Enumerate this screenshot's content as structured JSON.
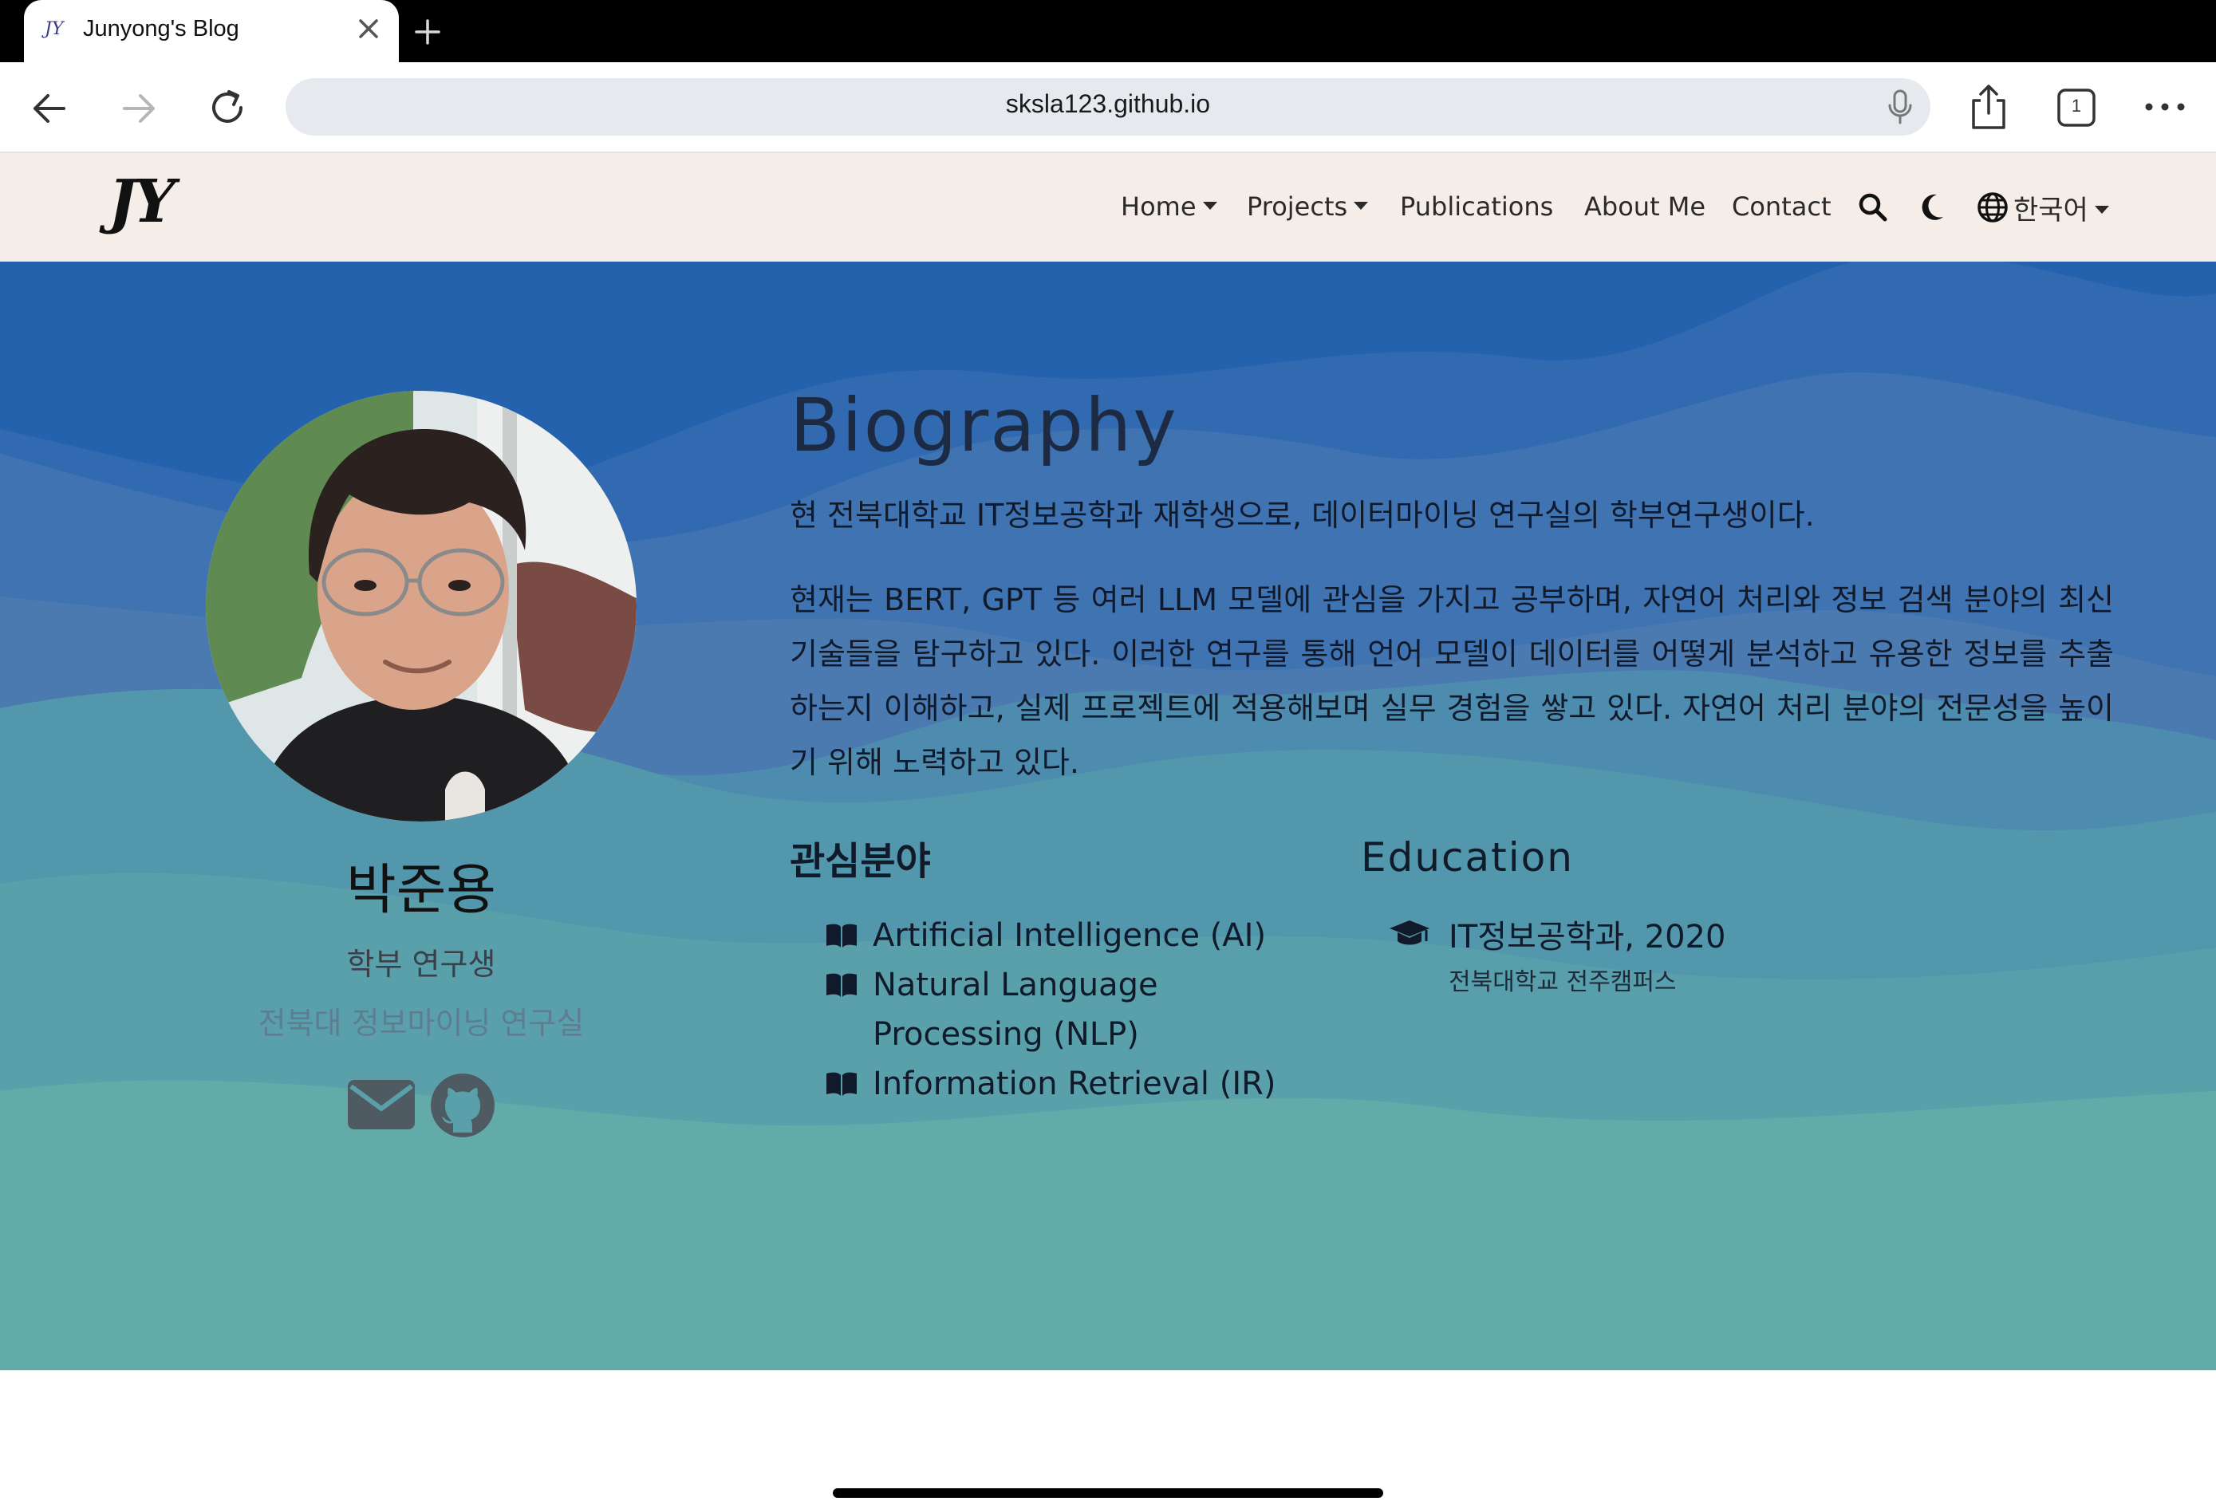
{
  "browser": {
    "tab": {
      "favicon_text": "JY",
      "title": "Junyong's Blog"
    },
    "url": "sksla123.github.io",
    "tabs_count": "1"
  },
  "navbar": {
    "logo": "JY",
    "items": [
      {
        "label": "Home",
        "dropdown": true
      },
      {
        "label": "Projects",
        "dropdown": true
      },
      {
        "label": "Publications",
        "dropdown": false
      },
      {
        "label": "About Me",
        "dropdown": false
      },
      {
        "label": "Contact",
        "dropdown": false
      }
    ],
    "language": "한국어"
  },
  "profile": {
    "name": "박준용",
    "role": "학부 연구생",
    "lab": "전북대 정보마이닝 연구실",
    "links": [
      "email-icon",
      "github-icon"
    ]
  },
  "bio": {
    "title": "Biography",
    "p1": "현 전북대학교 IT정보공학과 재학생으로, 데이터마이닝 연구실의 학부연구생이다.",
    "p2": "현재는 BERT, GPT 등 여러 LLM 모델에 관심을 가지고 공부하며, 자연어 처리와 정보 검색 분야의 최신 기술들을 탐구하고 있다. 이러한 연구를 통해 언어 모델이 데이터를 어떻게 분석하고 유용한 정보를 추출하는지 이해하고, 실제 프로젝트에 적용해보며 실무 경험을 쌓고 있다. 자연어 처리 분야의 전문성을 높이기 위해 노력하고 있다."
  },
  "interests": {
    "title": "관심분야",
    "items": [
      "Artificial Intelligence (AI)",
      "Natural Language Processing (NLP)",
      "Information Retrieval (IR)"
    ]
  },
  "education": {
    "title": "Education",
    "degree": "IT정보공학과, 2020",
    "school": "전북대학교 전주캠퍼스"
  },
  "colors": {
    "hero_top": "#2562ad",
    "hero_bottom": "#62aba8",
    "navbar_bg": "#f5ede8"
  }
}
